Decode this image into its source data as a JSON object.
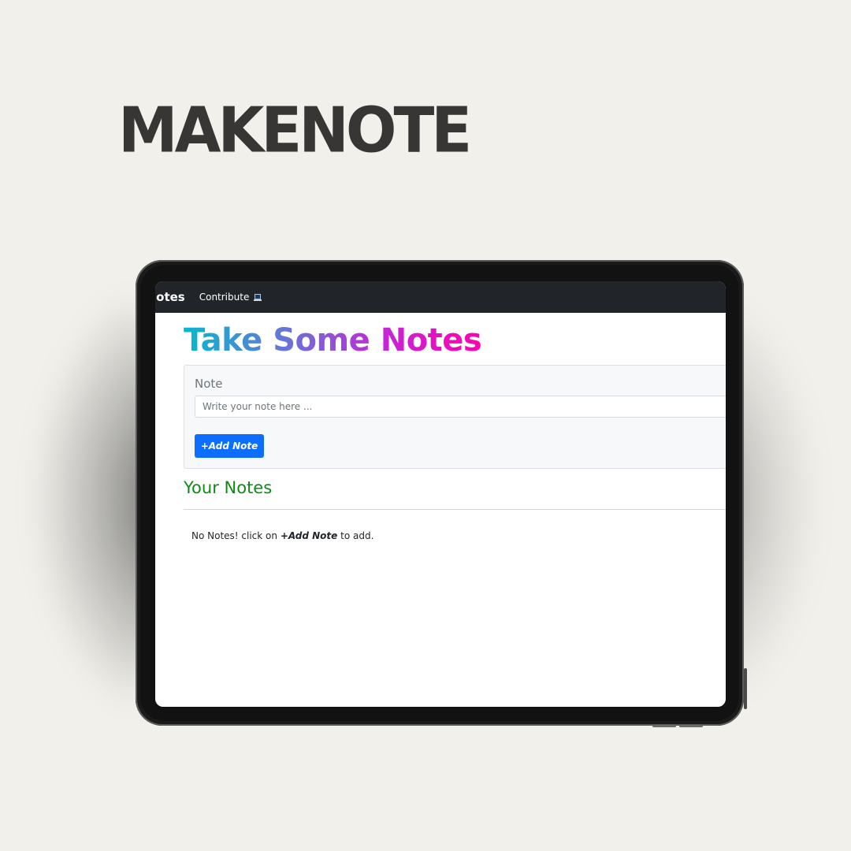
{
  "brand": {
    "title": "MAKENOTE"
  },
  "navbar": {
    "brand_label": "lotes",
    "contribute_label": "Contribute",
    "contribute_icon": "laptop-icon"
  },
  "main": {
    "heading": "Take Some Notes",
    "heading_gradient": [
      "#07b8cc",
      "#6a73d8",
      "#c02ad8",
      "#ff00b0"
    ],
    "note_form": {
      "label": "Note",
      "input_value": "",
      "input_placeholder": "Write your note here ...",
      "add_button_label": "+Add Note",
      "add_button_color": "#0d6efd"
    },
    "notes_section": {
      "title": "Your Notes",
      "title_color": "#0e8a16",
      "empty_prefix": "No Notes! click on ",
      "empty_emphasis": "+Add Note",
      "empty_suffix": " to add."
    }
  }
}
